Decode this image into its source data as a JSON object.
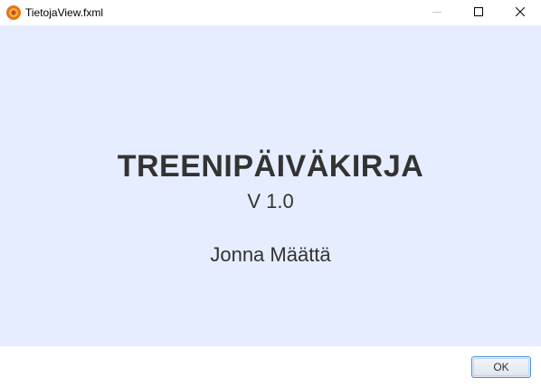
{
  "window": {
    "title": "TietojaView.fxml",
    "icon": "app-icon"
  },
  "titlebar_controls": {
    "minimize_icon": "minimize-icon",
    "maximize_icon": "maximize-icon",
    "close_icon": "close-icon"
  },
  "content": {
    "app_title": "TREENIPÄIVÄKIRJA",
    "version": "V 1.0",
    "author": "Jonna Määttä"
  },
  "footer": {
    "ok_label": "OK"
  },
  "colors": {
    "content_background": "#e6edfe",
    "text": "#333333",
    "ok_border": "#4a8fd9",
    "app_icon": "#e8731a"
  }
}
